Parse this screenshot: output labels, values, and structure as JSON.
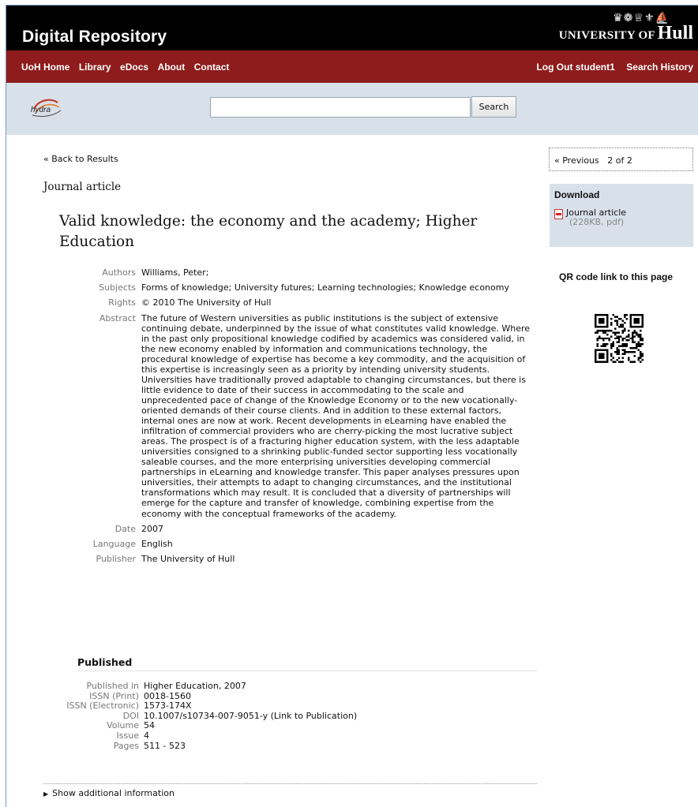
{
  "header": {
    "site_title": "Digital Repository",
    "university": {
      "prefix": "UNIVERSITY OF",
      "name": "Hull",
      "crest": "♛❁♕⚜⛵"
    }
  },
  "nav": {
    "left": [
      "UoH Home",
      "Library",
      "eDocs",
      "About",
      "Contact"
    ],
    "logout": "Log Out student1",
    "search_history": "Search History"
  },
  "search": {
    "logo_text": "hydra",
    "value": "",
    "button": "Search"
  },
  "main": {
    "back_link": "« Back to Results",
    "doc_type": "Journal article",
    "title": "Valid knowledge: the economy and the academy; Higher Education",
    "fields": {
      "authors_label": "Authors",
      "authors": "Williams, Peter;",
      "subjects_label": "Subjects",
      "subjects": "Forms of knowledge; University futures; Learning technologies; Knowledge economy",
      "rights_label": "Rights",
      "rights": "© 2010 The University of Hull",
      "abstract_label": "Abstract",
      "abstract": "The future of Western universities as public institutions is the subject of extensive continuing debate, underpinned by the issue of what constitutes valid knowledge. Where in the past only propositional knowledge codified by academics was considered valid, in the new economy enabled by information and communications technology, the procedural knowledge of expertise has become a key commodity, and the acquisition of this expertise is increasingly seen as a priority by intending university students. Universities have traditionally proved adaptable to changing circumstances, but there is little evidence to date of their success in accommodating to the scale and unprecedented pace of change of the Knowledge Economy or to the new vocationally-oriented demands of their course clients. And in addition to these external factors, internal ones are now at work. Recent developments in eLearning have enabled the infiltration of commercial providers who are cherry-picking the most lucrative subject areas. The prospect is of a fracturing higher education system, with the less adaptable universities consigned to a shrinking public-funded sector supporting less vocationally saleable courses, and the more enterprising universities developing commercial partnerships in eLearning and knowledge transfer. This paper analyses pressures upon universities, their attempts to adapt to changing circumstances, and the institutional transformations which may result. It is concluded that a diversity of partnerships will emerge for the capture and transfer of knowledge, combining expertise from the economy with the conceptual frameworks of the academy.",
      "date_label": "Date",
      "date": "2007",
      "language_label": "Language",
      "language": "English",
      "publisher_label": "Publisher",
      "publisher": "The University of Hull"
    },
    "published": {
      "heading": "Published",
      "published_in_label": "Published in",
      "published_in": "Higher Education, 2007",
      "issn_print_label": "ISSN (Print)",
      "issn_print": "0018-1560",
      "issn_electronic_label": "ISSN (Electronic)",
      "issn_electronic": "1573-174X",
      "doi_label": "DOI",
      "doi": "10.1007/s10734-007-9051-y (Link to Publication)",
      "volume_label": "Volume",
      "volume": "54",
      "issue_label": "Issue",
      "issue": "4",
      "pages_label": "Pages",
      "pages": "511 - 523"
    },
    "show_more": "Show additional information"
  },
  "sidebar": {
    "previous": "« Previous",
    "position": "2 of 2",
    "download_heading": "Download",
    "download_item": "Journal article",
    "download_meta": "(228KB, pdf)",
    "qr_title": "QR code link to this page"
  },
  "colors": {
    "topbar": "#000000",
    "navbar": "#8e1c1c",
    "searchband": "#d8e1ea"
  }
}
